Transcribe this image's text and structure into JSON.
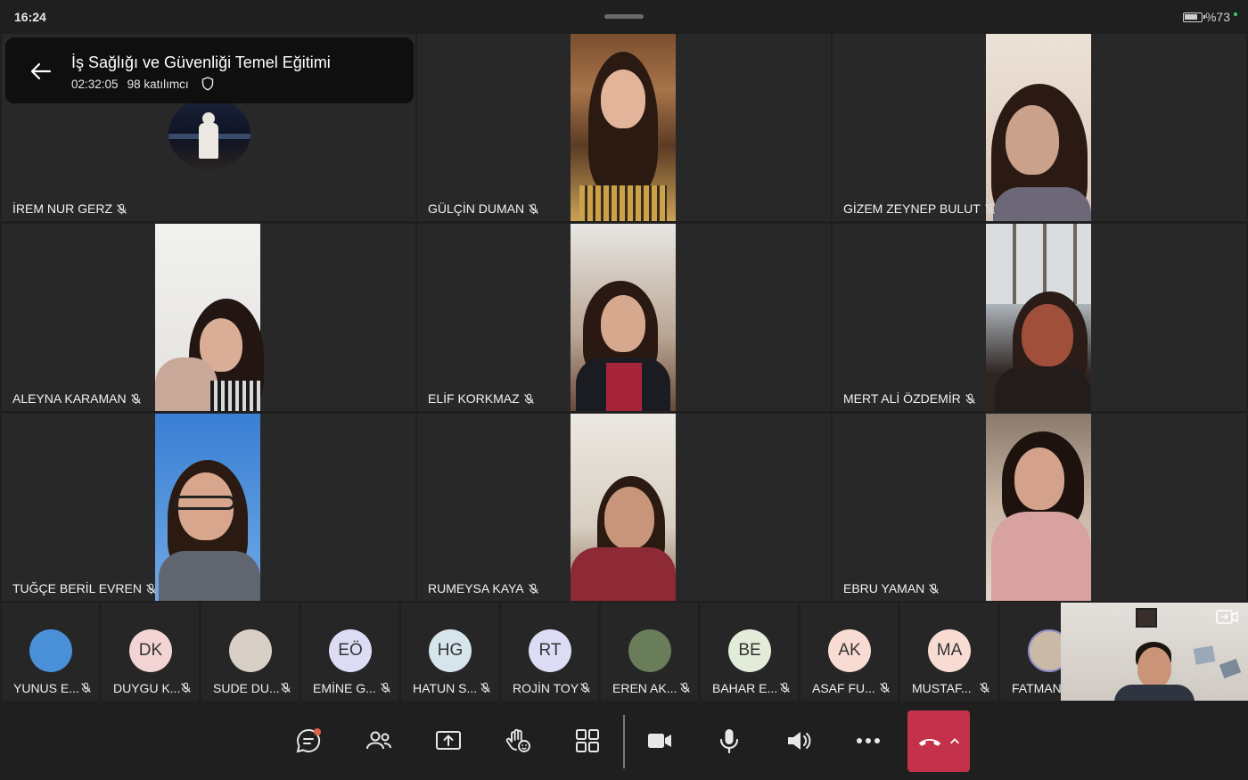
{
  "status_bar": {
    "time": "16:24",
    "battery": "%73"
  },
  "meeting": {
    "title": "İş Sağlığı ve Güvenliği Temel Eğitimi",
    "duration": "02:32:05",
    "participants": "98 katılımcı"
  },
  "grid": [
    {
      "name": "İREM NUR GERZ"
    },
    {
      "name": "GÜLÇİN DUMAN"
    },
    {
      "name": "GİZEM ZEYNEP BULUT"
    },
    {
      "name": "ALEYNA KARAMAN"
    },
    {
      "name": "ELİF KORKMAZ"
    },
    {
      "name": "MERT ALİ ÖZDEMİR"
    },
    {
      "name": "TUĞÇE BERİL EVREN"
    },
    {
      "name": "RUMEYSA KAYA"
    },
    {
      "name": "EBRU YAMAN"
    }
  ],
  "strip": [
    {
      "name": "YUNUS E...",
      "initials": "",
      "color": "#4a90d9"
    },
    {
      "name": "DUYGU K...",
      "initials": "DK",
      "color": "#f3d4d4"
    },
    {
      "name": "SUDE DU...",
      "initials": "",
      "color": "#d8cfc6"
    },
    {
      "name": "EMİNE G...",
      "initials": "EÖ",
      "color": "#dcdcf5"
    },
    {
      "name": "HATUN S...",
      "initials": "HG",
      "color": "#d6e4ec"
    },
    {
      "name": "ROJİN TOY",
      "initials": "RT",
      "color": "#dcdcf5"
    },
    {
      "name": "EREN AK...",
      "initials": "",
      "color": "#6a7d5a"
    },
    {
      "name": "BAHAR E...",
      "initials": "BE",
      "color": "#e2ecd9"
    },
    {
      "name": "ASAF FU...",
      "initials": "AK",
      "color": "#f8dcd4"
    },
    {
      "name": "MUSTAF...",
      "initials": "MA",
      "color": "#f8dcd4"
    },
    {
      "name": "FATMAN",
      "initials": "",
      "color": "#c9b9a6"
    }
  ],
  "controls": [
    "chat-icon",
    "people-icon",
    "share-screen-icon",
    "raise-hand-icon",
    "layout-icon",
    "camera-icon",
    "mic-icon",
    "speaker-icon",
    "more-icon",
    "hang-up-icon"
  ],
  "colors": {
    "hangup": "#c4314b",
    "background": "#1f1f1f",
    "tile": "#282828",
    "accent_dot": "#e0604a"
  }
}
